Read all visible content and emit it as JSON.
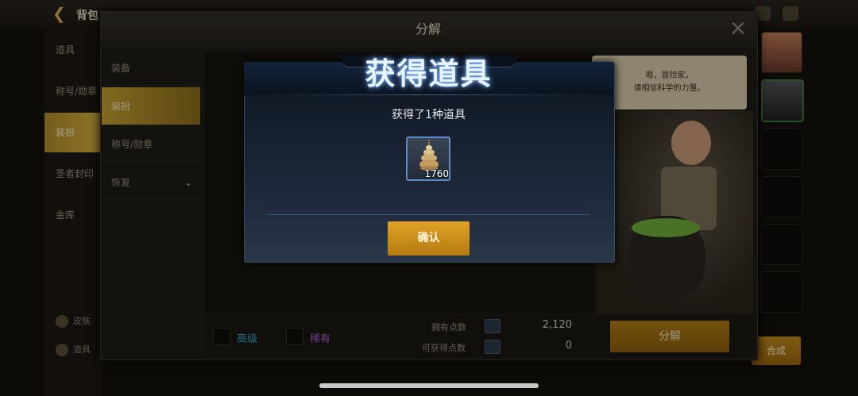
{
  "app": {
    "back_title": "背包"
  },
  "left_nav": {
    "items": [
      "道具",
      "称号/勋章",
      "装扮",
      "圣者封印",
      "金库"
    ],
    "active": "装扮"
  },
  "left_bottom": [
    "皮肤",
    "道具"
  ],
  "decompose": {
    "title": "分解",
    "categories": [
      "装备",
      "装扮",
      "称号/勋章",
      "恢复"
    ],
    "active_category": "装扮",
    "filters": {
      "high": "高级",
      "rare": "稀有"
    },
    "points": {
      "own_label": "拥有点数",
      "own_value": "2,120",
      "gain_label": "可获得点数",
      "gain_value": "0"
    },
    "button": "分解"
  },
  "npc": {
    "speech_line1": "嗯，冒险家。",
    "speech_line2": "请相信科学的力量。"
  },
  "synthesize": {
    "label": "合成"
  },
  "modal": {
    "title": "获得道具",
    "message": "获得了1种道具",
    "item_count": "1760",
    "confirm": "确认"
  },
  "colors": {
    "accent_gold": "#c48a1c",
    "modal_bg": "#1b2738",
    "high_grade": "#3aa6d6",
    "rare_grade": "#b05ed0"
  },
  "icons": [
    "back-arrow-icon",
    "close-icon",
    "chevron-down-icon",
    "message-icon",
    "chat-icon",
    "item-icon"
  ]
}
